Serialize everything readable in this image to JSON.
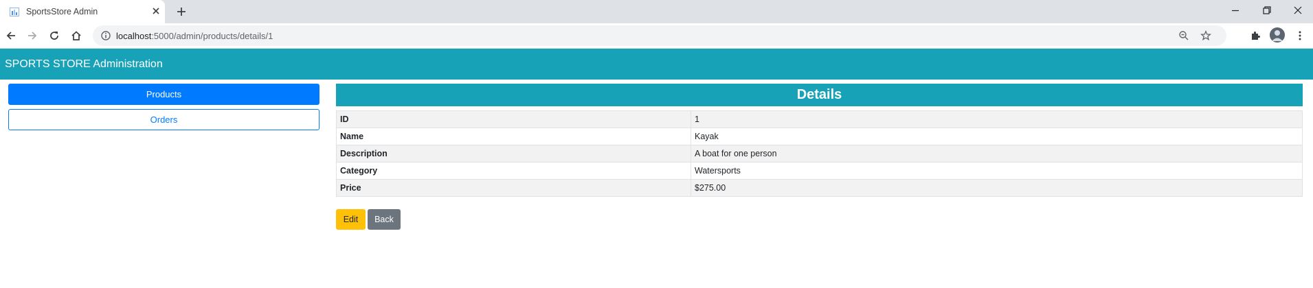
{
  "browser": {
    "tab_title": "SportsStore Admin",
    "url_host": "localhost",
    "url_rest": ":5000/admin/products/details/1"
  },
  "navbar": {
    "brand": "SPORTS STORE Administration"
  },
  "sidebar": {
    "products_label": "Products",
    "orders_label": "Orders"
  },
  "details": {
    "header": "Details",
    "rows": [
      {
        "label": "ID",
        "value": "1"
      },
      {
        "label": "Name",
        "value": "Kayak"
      },
      {
        "label": "Description",
        "value": "A boat for one person"
      },
      {
        "label": "Category",
        "value": "Watersports"
      },
      {
        "label": "Price",
        "value": "$275.00"
      }
    ]
  },
  "actions": {
    "edit_label": "Edit",
    "back_label": "Back"
  },
  "colors": {
    "navbar": "#17a2b8",
    "primary": "#007bff",
    "warning": "#ffc107",
    "secondary": "#6c757d"
  },
  "icons": {
    "tab": [
      "favicon-icon",
      "close-tab-icon",
      "new-tab-icon"
    ],
    "window": [
      "minimize-icon",
      "restore-icon",
      "close-window-icon"
    ],
    "toolbar": [
      "back-icon",
      "forward-icon",
      "reload-icon",
      "home-icon",
      "site-info-icon",
      "zoom-icon",
      "bookmark-star-icon",
      "extensions-icon",
      "profile-avatar",
      "menu-icon"
    ]
  }
}
